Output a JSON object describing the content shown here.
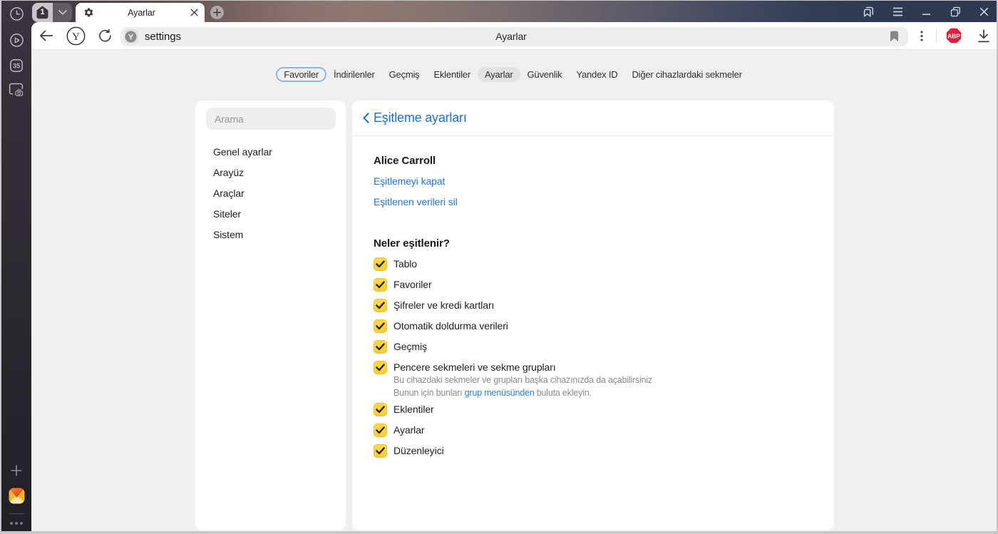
{
  "window": {
    "controls": {
      "panels": "side-panels",
      "menu": "menu",
      "minimize": "minimize",
      "maximize": "maximize",
      "close": "close"
    }
  },
  "tab_strip": {
    "tab_counter": "1",
    "active_tab_title": "Ayarlar"
  },
  "toolbar": {
    "url_host": "settings",
    "page_title": "Ayarlar",
    "abp_badge": "ABP"
  },
  "app_sidebar": {
    "tab_count_badge": "35"
  },
  "nav_chips": [
    {
      "label": "Favoriler",
      "state": "focused"
    },
    {
      "label": "İndirilenler",
      "state": "normal"
    },
    {
      "label": "Geçmiş",
      "state": "normal"
    },
    {
      "label": "Eklentiler",
      "state": "normal"
    },
    {
      "label": "Ayarlar",
      "state": "active"
    },
    {
      "label": "Güvenlik",
      "state": "normal"
    },
    {
      "label": "Yandex ID",
      "state": "normal"
    },
    {
      "label": "Diğer cihazlardaki sekmeler",
      "state": "normal"
    }
  ],
  "settings_sidebar": {
    "search_placeholder": "Arama",
    "items": [
      "Genel ayarlar",
      "Arayüz",
      "Araçlar",
      "Siteler",
      "Sistem"
    ]
  },
  "sync_panel": {
    "title": "Eşitleme ayarları",
    "account_name": "Alice Carroll",
    "links": [
      "Eşitlemeyi kapat",
      "Eşitlenen verileri sil"
    ],
    "section_title": "Neler eşitlenir?",
    "checkboxes": [
      {
        "label": "Tablo",
        "checked": true
      },
      {
        "label": "Favoriler",
        "checked": true
      },
      {
        "label": "Şifreler ve kredi kartları",
        "checked": true
      },
      {
        "label": "Otomatik doldurma verileri",
        "checked": true
      },
      {
        "label": "Geçmiş",
        "checked": true
      },
      {
        "label": "Pencere sekmeleri ve sekme grupları",
        "checked": true,
        "description_line1": "Bu cihazdaki sekmeler ve grupları başka cihazınızda da açabilirsiniz",
        "description_line2_prefix": "Bunun için bunları ",
        "description_link": "grup menüsünden",
        "description_line2_suffix": " buluta ekleyin."
      },
      {
        "label": "Eklentiler",
        "checked": true
      },
      {
        "label": "Ayarlar",
        "checked": true
      },
      {
        "label": "Düzenleyici",
        "checked": true
      }
    ]
  },
  "colors": {
    "accent_blue": "#1f74d4",
    "checkbox_yellow": "#f8cf33",
    "abp_red": "#e01e3c"
  }
}
